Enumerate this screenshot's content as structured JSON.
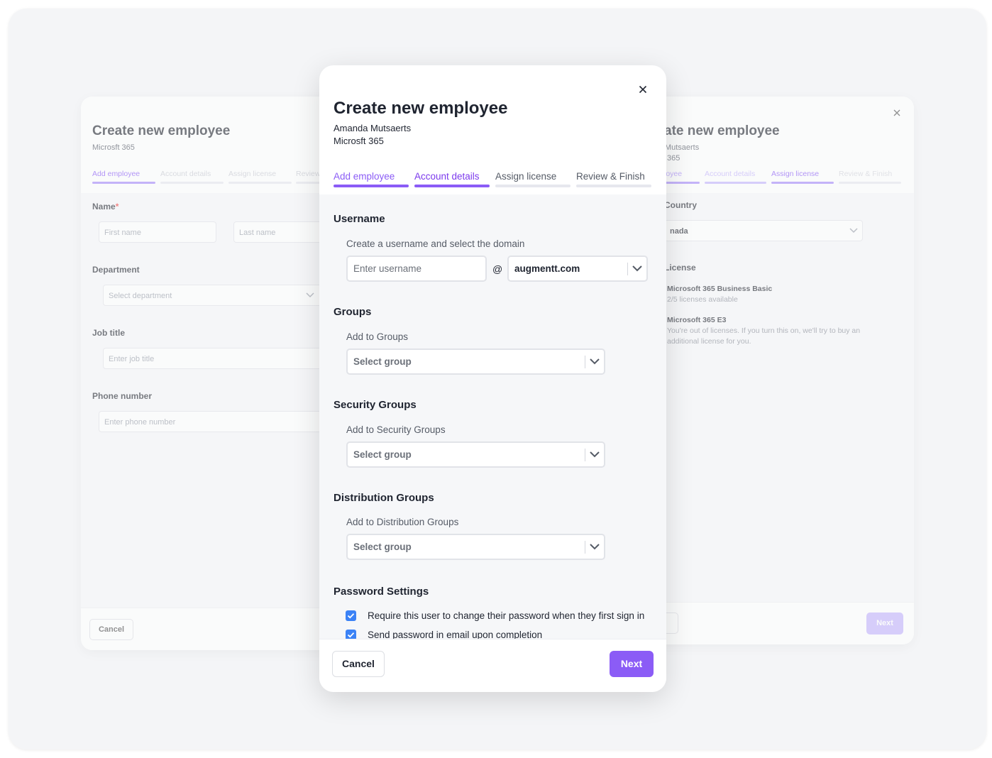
{
  "left": {
    "title": "Create new employee",
    "subtitle": "Microsft 365",
    "tabs": [
      "Add employee",
      "Account details",
      "Assign license",
      "Review & Finish"
    ],
    "name_label": "Name",
    "required_mark": "*",
    "first_name_placeholder": "First name",
    "last_name_placeholder": "Last name",
    "department_label": "Department",
    "department_placeholder": "Select department",
    "job_label": "Job title",
    "job_placeholder": "Enter job title",
    "phone_label": "Phone number",
    "phone_placeholder": "Enter phone number",
    "cancel": "Cancel"
  },
  "main": {
    "title": "Create new employee",
    "employee_name": "Amanda Mutsaerts",
    "product": "Microsft 365",
    "tabs": [
      {
        "label": "Add employee",
        "state": "done"
      },
      {
        "label": "Account details",
        "state": "active"
      },
      {
        "label": "Assign license",
        "state": "todo"
      },
      {
        "label": "Review & Finish",
        "state": "todo"
      }
    ],
    "username": {
      "heading": "Username",
      "hint": "Create a username and select the domain",
      "placeholder": "Enter username",
      "at": "@",
      "domain": "augmentt.com"
    },
    "groups": {
      "heading": "Groups",
      "hint": "Add to Groups",
      "placeholder": "Select group"
    },
    "security_groups": {
      "heading": "Security Groups",
      "hint": "Add to Security Groups",
      "placeholder": "Select group"
    },
    "distribution_groups": {
      "heading": "Distribution Groups",
      "hint": "Add to Distribution Groups",
      "placeholder": "Select group"
    },
    "password": {
      "heading": "Password Settings",
      "options": [
        {
          "label": "Require this user to change their password when they first sign in",
          "checked": true
        },
        {
          "label": "Send password in email upon completion",
          "checked": true
        }
      ]
    },
    "cancel": "Cancel",
    "next": "Next"
  },
  "right": {
    "title": "ate new employee",
    "subtitle1": "Mutsaerts",
    "subtitle2": "365",
    "tabs": [
      "loyee",
      "Account details",
      "Assign license",
      "Review & Finish"
    ],
    "country_label": "Country",
    "country_value": "nada",
    "license_label": "License",
    "licenses": [
      {
        "name": "Microsoft 365 Business Basic",
        "desc": "2/5 licenses available"
      },
      {
        "name": "Microsoft 365 E3",
        "desc1": "You're out of licenses. If you turn this on, we'll try to buy an",
        "desc2": "additional license for you."
      }
    ],
    "next": "Next"
  },
  "colors": {
    "accent": "#8b5cf6",
    "accent_light": "#c4b5fd",
    "checkbox": "#3b82f6"
  }
}
